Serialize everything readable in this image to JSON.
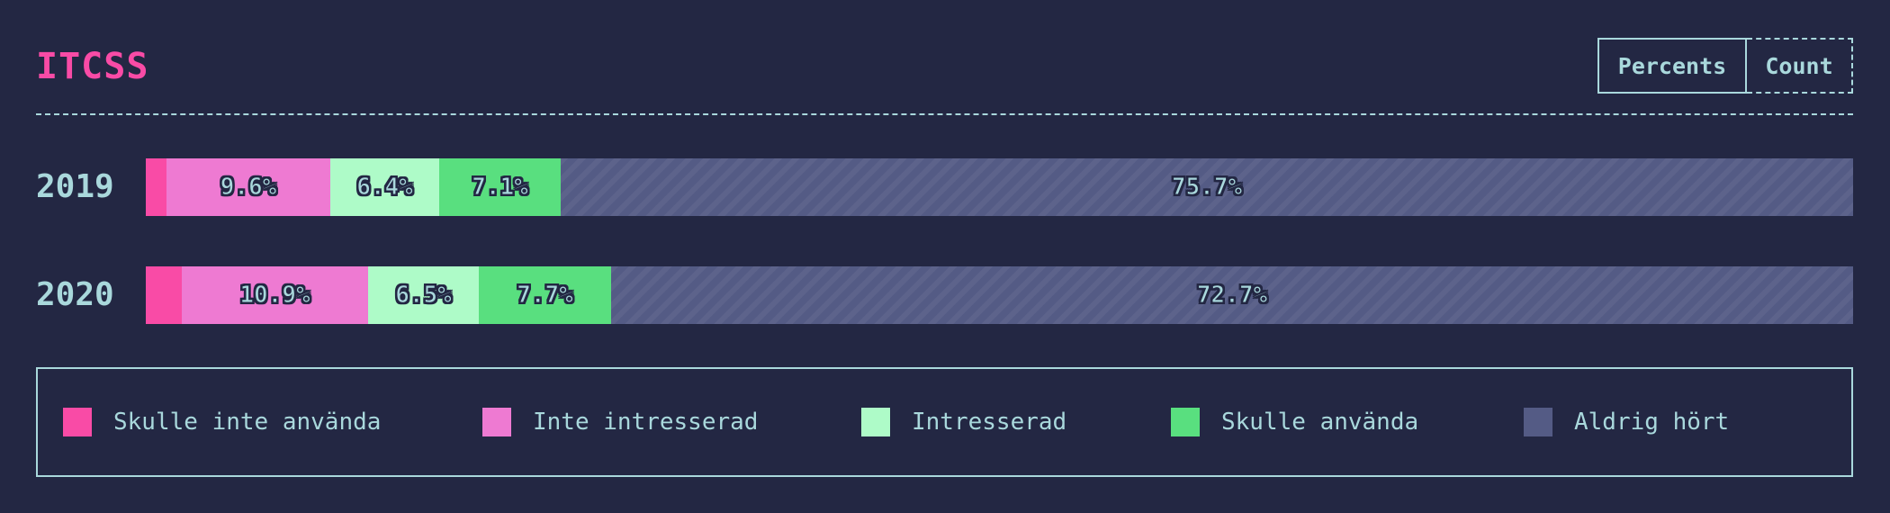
{
  "title": "ITCSS",
  "toggle": {
    "percents_label": "Percents",
    "count_label": "Count",
    "selected": "percents"
  },
  "colors": {
    "background": "#232743",
    "text": "#a9d8dc",
    "title": "#f94ba6"
  },
  "chart_data": {
    "type": "bar",
    "orientation": "horizontal",
    "stacked": true,
    "normalized": true,
    "categories": [
      "2019",
      "2020"
    ],
    "series": [
      {
        "name": "Skulle inte använda",
        "color": "#f94ba6",
        "values": [
          1.2,
          2.1
        ],
        "labels": [
          "",
          ""
        ]
      },
      {
        "name": "Inte intresserad",
        "color": "#ee7ad2",
        "values": [
          9.6,
          10.9
        ],
        "labels": [
          "9.6%",
          "10.9%"
        ]
      },
      {
        "name": "Intresserad",
        "color": "#aefbc8",
        "values": [
          6.4,
          6.5
        ],
        "labels": [
          "6.4%",
          "6.5%"
        ]
      },
      {
        "name": "Skulle använda",
        "color": "#59df7f",
        "values": [
          7.1,
          7.7
        ],
        "labels": [
          "7.1%",
          "7.7%"
        ]
      },
      {
        "name": "Aldrig hört",
        "color": "#545b85",
        "values": [
          75.7,
          72.7
        ],
        "labels": [
          "75.7%",
          "72.7%"
        ],
        "pattern": "hatched"
      }
    ],
    "legend_position": "bottom",
    "grid": false
  }
}
